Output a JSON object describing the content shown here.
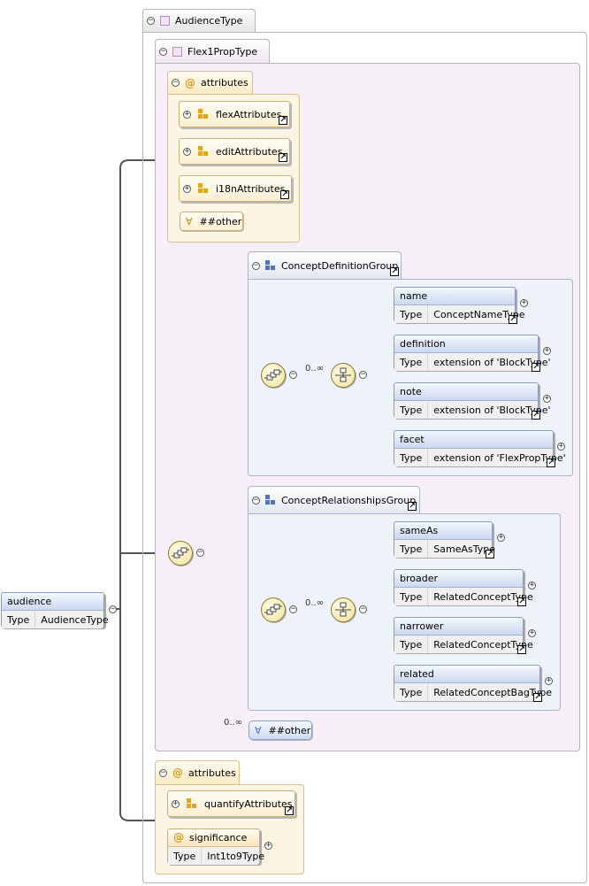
{
  "types": {
    "audience_type": "AudienceType",
    "flex1_prop_type": "Flex1PropType"
  },
  "attributes_label": "attributes",
  "attribute_groups": {
    "flex": "flexAttributes",
    "edit": "editAttributes",
    "i18n": "i18nAttributes",
    "quantify": "quantifyAttributes"
  },
  "any_other": "##other",
  "groups": {
    "concept_definition": "ConceptDefinitionGroup",
    "concept_relationships": "ConceptRelationshipsGroup"
  },
  "cardinality": "0..∞",
  "type_key": "Type",
  "root": {
    "name": "audience",
    "type": "AudienceType"
  },
  "definition_elements": [
    {
      "name": "name",
      "type": "ConceptNameType"
    },
    {
      "name": "definition",
      "type": "extension of 'BlockType'"
    },
    {
      "name": "note",
      "type": "extension of 'BlockType'"
    },
    {
      "name": "facet",
      "type": "extension of 'FlexPropType'"
    }
  ],
  "relationship_elements": [
    {
      "name": "sameAs",
      "type": "SameAsType"
    },
    {
      "name": "broader",
      "type": "RelatedConceptType"
    },
    {
      "name": "narrower",
      "type": "RelatedConceptType"
    },
    {
      "name": "related",
      "type": "RelatedConceptBagType"
    }
  ],
  "significance": {
    "name": "significance",
    "type": "Int1to9Type"
  },
  "icons": {
    "expand": "⊕",
    "collapse": "⊖",
    "link": "link-arrow-icon",
    "attribute": "@",
    "any": "∀"
  }
}
